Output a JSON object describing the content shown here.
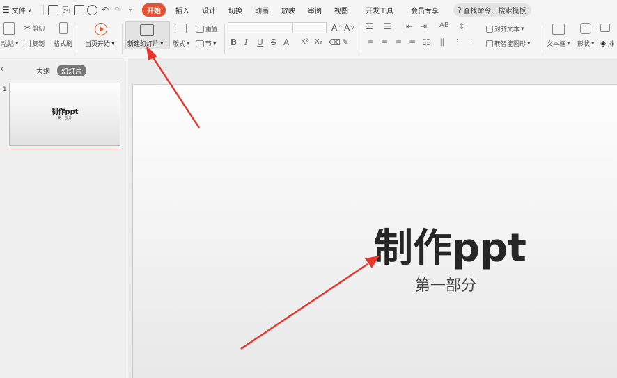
{
  "menubar": {
    "file_label": "文件",
    "tabs": [
      {
        "label": "开始",
        "active": true
      },
      {
        "label": "插入"
      },
      {
        "label": "设计"
      },
      {
        "label": "切换"
      },
      {
        "label": "动画"
      },
      {
        "label": "放映"
      },
      {
        "label": "审阅"
      },
      {
        "label": "视图"
      },
      {
        "label": "开发工具"
      },
      {
        "label": "会员专享"
      }
    ],
    "search_placeholder": "查找命令、搜索模板",
    "accent_color": "#e8502f"
  },
  "ribbon": {
    "paste": "粘贴",
    "cut": "剪切",
    "copy": "复制",
    "format_painter": "格式刷",
    "play_from_current": "当页开始",
    "new_slide": "新建幻灯片",
    "layout": "版式",
    "reset": "重置",
    "section": "节",
    "align_text": "对齐文本",
    "smartart": "转智能图形",
    "textbox": "文本框",
    "shape": "形状",
    "arrange": "排",
    "font_buttons": [
      "B",
      "I",
      "U",
      "S",
      "A",
      "X²",
      "X₂"
    ]
  },
  "left_pane": {
    "tab_outline": "大纲",
    "tab_slides": "幻灯片",
    "slides": [
      {
        "number": "1",
        "title": "制作ppt",
        "subtitle": "第一部分"
      }
    ]
  },
  "slide": {
    "title": "制作ppt",
    "subtitle": "第一部分"
  },
  "annotations": {
    "arrow_color": "#e8352c"
  }
}
